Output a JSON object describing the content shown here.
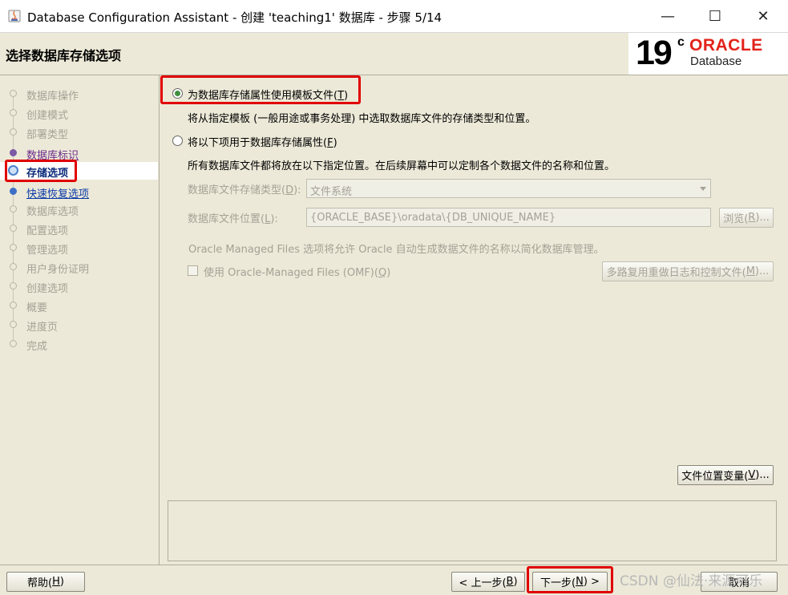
{
  "window": {
    "title": "Database Configuration Assistant - 创建 'teaching1' 数据库 - 步骤 5/14",
    "minimize_glyph": "—",
    "maximize_glyph": "☐",
    "close_glyph": "✕"
  },
  "header": {
    "page_title": "选择数据库存储选项",
    "logo_version": "19",
    "logo_suffix": "c",
    "logo_brand": "ORACLE",
    "logo_product": "Database"
  },
  "sidebar": {
    "steps": [
      {
        "label": "数据库操作",
        "state": "disabled"
      },
      {
        "label": "创建模式",
        "state": "disabled"
      },
      {
        "label": "部署类型",
        "state": "disabled"
      },
      {
        "label": "数据库标识",
        "state": "visited"
      },
      {
        "label": "存储选项",
        "state": "current"
      },
      {
        "label": "快速恢复选项",
        "state": "link"
      },
      {
        "label": "数据库选项",
        "state": "disabled"
      },
      {
        "label": "配置选项",
        "state": "disabled"
      },
      {
        "label": "管理选项",
        "state": "disabled"
      },
      {
        "label": "用户身份证明",
        "state": "disabled"
      },
      {
        "label": "创建选项",
        "state": "disabled"
      },
      {
        "label": "概要",
        "state": "disabled"
      },
      {
        "label": "进度页",
        "state": "disabled"
      },
      {
        "label": "完成",
        "state": "disabled"
      }
    ]
  },
  "main": {
    "option1": {
      "label_prefix": "为数据库存储属性使用模板文件(",
      "mnemonic": "T",
      "label_suffix": ")",
      "checked": true,
      "description": "将从指定模板 (一般用途或事务处理) 中选取数据库文件的存储类型和位置。"
    },
    "option2": {
      "label_prefix": "将以下项用于数据库存储属性(",
      "mnemonic": "F",
      "label_suffix": ")",
      "checked": false,
      "description": "所有数据库文件都将放在以下指定位置。在后续屏幕中可以定制各个数据文件的名称和位置。"
    },
    "storage_type": {
      "label_prefix": "数据库文件存储类型(",
      "mnemonic": "D",
      "label_suffix": "):",
      "value": "文件系统"
    },
    "file_location": {
      "label_prefix": "数据库文件位置(",
      "mnemonic": "L",
      "label_suffix": "):",
      "value": "{ORACLE_BASE}\\oradata\\{DB_UNIQUE_NAME}",
      "browse_prefix": "浏览(",
      "browse_mnemonic": "R",
      "browse_suffix": ")..."
    },
    "omf_note": "Oracle Managed Files 选项将允许 Oracle 自动生成数据文件的名称以简化数据库管理。",
    "omf_checkbox": {
      "label_prefix": "使用 Oracle-Managed Files (OMF)(",
      "mnemonic": "Q",
      "label_suffix": ")",
      "checked": false
    },
    "multiplex_button": {
      "prefix": "多路复用重做日志和控制文件(",
      "mnemonic": "M",
      "suffix": ")..."
    },
    "file_vars_button": {
      "prefix": "文件位置变量(",
      "mnemonic": "V",
      "suffix": ")..."
    }
  },
  "footer": {
    "help": {
      "prefix": "帮助(",
      "mnemonic": "H",
      "suffix": ")"
    },
    "back": {
      "prefix": "< 上一步(",
      "mnemonic": "B",
      "suffix": ")"
    },
    "next": {
      "prefix": "下一步(",
      "mnemonic": "N",
      "suffix": ") >"
    },
    "cancel": "取消",
    "watermark": "CSDN @仙法·来源可乐"
  },
  "colors": {
    "highlight": "#e00000",
    "oracle_red": "#e2231a",
    "background": "#ece9d8"
  }
}
